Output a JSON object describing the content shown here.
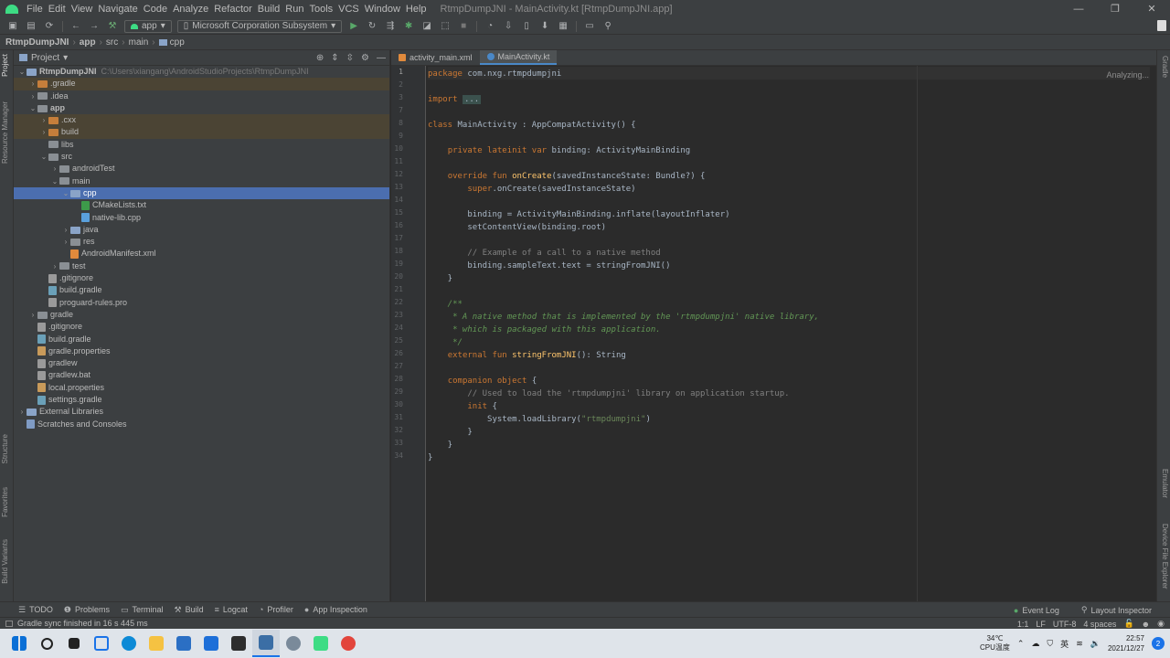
{
  "menubar": {
    "items": [
      "File",
      "Edit",
      "View",
      "Navigate",
      "Code",
      "Analyze",
      "Refactor",
      "Build",
      "Run",
      "Tools",
      "VCS",
      "Window",
      "Help"
    ],
    "window_title": "RtmpDumpJNI - MainActivity.kt [RtmpDumpJNI.app]",
    "minimize": "—",
    "maximize": "❐",
    "close": "✕"
  },
  "toolbar": {
    "run_config": "app",
    "device": "Microsoft Corporation Subsystem"
  },
  "breadcrumb": [
    "RtmpDumpJNI",
    "app",
    "src",
    "main",
    "cpp"
  ],
  "left_stripe": {
    "project": "Project",
    "resource_manager": "Resource Manager",
    "structure": "Structure",
    "favorites": "Favorites",
    "build_variants": "Build Variants"
  },
  "right_stripe": {
    "gradle": "Gradle",
    "emulator": "Emulator",
    "device_file_explorer": "Device File Explorer"
  },
  "project_panel": {
    "title": "Project",
    "tree": [
      {
        "label": "RtmpDumpJNI",
        "path": "C:\\Users\\xiangang\\AndroidStudioProjects\\RtmpDumpJNI",
        "depth": 0,
        "arrow": "⌄",
        "kind": "module",
        "bold": true
      },
      {
        "label": ".gradle",
        "depth": 1,
        "arrow": "›",
        "kind": "folder-orange",
        "hl": true
      },
      {
        "label": ".idea",
        "depth": 1,
        "arrow": "›",
        "kind": "folder"
      },
      {
        "label": "app",
        "depth": 1,
        "arrow": "⌄",
        "kind": "folder",
        "bold": true
      },
      {
        "label": ".cxx",
        "depth": 2,
        "arrow": "›",
        "kind": "folder-orange",
        "hl": true
      },
      {
        "label": "build",
        "depth": 2,
        "arrow": "›",
        "kind": "folder-orange",
        "hl": true
      },
      {
        "label": "libs",
        "depth": 2,
        "arrow": "",
        "kind": "folder"
      },
      {
        "label": "src",
        "depth": 2,
        "arrow": "⌄",
        "kind": "folder"
      },
      {
        "label": "androidTest",
        "depth": 3,
        "arrow": "›",
        "kind": "folder"
      },
      {
        "label": "main",
        "depth": 3,
        "arrow": "⌄",
        "kind": "folder"
      },
      {
        "label": "cpp",
        "depth": 4,
        "arrow": "⌄",
        "kind": "folder-blue",
        "sel": true
      },
      {
        "label": "CMakeLists.txt",
        "depth": 5,
        "arrow": "",
        "kind": "cmake"
      },
      {
        "label": "native-lib.cpp",
        "depth": 5,
        "arrow": "",
        "kind": "cpp"
      },
      {
        "label": "java",
        "depth": 4,
        "arrow": "›",
        "kind": "folder-blue"
      },
      {
        "label": "res",
        "depth": 4,
        "arrow": "›",
        "kind": "folder"
      },
      {
        "label": "AndroidManifest.xml",
        "depth": 4,
        "arrow": "",
        "kind": "xml"
      },
      {
        "label": "test",
        "depth": 3,
        "arrow": "›",
        "kind": "folder"
      },
      {
        "label": ".gitignore",
        "depth": 2,
        "arrow": "",
        "kind": "file"
      },
      {
        "label": "build.gradle",
        "depth": 2,
        "arrow": "",
        "kind": "gradle"
      },
      {
        "label": "proguard-rules.pro",
        "depth": 2,
        "arrow": "",
        "kind": "file"
      },
      {
        "label": "gradle",
        "depth": 1,
        "arrow": "›",
        "kind": "folder"
      },
      {
        "label": ".gitignore",
        "depth": 1,
        "arrow": "",
        "kind": "file"
      },
      {
        "label": "build.gradle",
        "depth": 1,
        "arrow": "",
        "kind": "gradle"
      },
      {
        "label": "gradle.properties",
        "depth": 1,
        "arrow": "",
        "kind": "props"
      },
      {
        "label": "gradlew",
        "depth": 1,
        "arrow": "",
        "kind": "file"
      },
      {
        "label": "gradlew.bat",
        "depth": 1,
        "arrow": "",
        "kind": "file"
      },
      {
        "label": "local.properties",
        "depth": 1,
        "arrow": "",
        "kind": "props"
      },
      {
        "label": "settings.gradle",
        "depth": 1,
        "arrow": "",
        "kind": "gradle"
      },
      {
        "label": "External Libraries",
        "depth": 0,
        "arrow": "›",
        "kind": "lib"
      },
      {
        "label": "Scratches and Consoles",
        "depth": 0,
        "arrow": "",
        "kind": "scratch"
      }
    ]
  },
  "editor": {
    "tabs": [
      {
        "label": "activity_main.xml",
        "active": false
      },
      {
        "label": "MainActivity.kt",
        "active": true
      }
    ],
    "status": "Analyzing...",
    "lines": [
      {
        "n": "1",
        "parts": [
          [
            "kw",
            "package "
          ],
          [
            "",
            "com.nxg.rtmpdumpjni"
          ]
        ]
      },
      {
        "n": "2",
        "parts": []
      },
      {
        "n": "3",
        "parts": [
          [
            "kw",
            "import "
          ],
          [
            "fold",
            "..."
          ]
        ]
      },
      {
        "n": "7",
        "parts": []
      },
      {
        "n": "8",
        "parts": [
          [
            "kw",
            "class "
          ],
          [
            "",
            "MainActivity : AppCompatActivity() {"
          ]
        ]
      },
      {
        "n": "9",
        "parts": []
      },
      {
        "n": "10",
        "parts": [
          [
            "",
            "    "
          ],
          [
            "kw",
            "private lateinit var "
          ],
          [
            "",
            "binding: ActivityMainBinding"
          ]
        ]
      },
      {
        "n": "11",
        "parts": []
      },
      {
        "n": "12",
        "parts": [
          [
            "",
            "    "
          ],
          [
            "kw",
            "override fun "
          ],
          [
            "fn",
            "onCreate"
          ],
          [
            "",
            "(savedInstanceState: Bundle?) {"
          ]
        ]
      },
      {
        "n": "13",
        "parts": [
          [
            "",
            "        "
          ],
          [
            "kw",
            "super"
          ],
          [
            "",
            ".onCreate(savedInstanceState)"
          ]
        ]
      },
      {
        "n": "14",
        "parts": []
      },
      {
        "n": "15",
        "parts": [
          [
            "",
            "        binding = ActivityMainBinding.inflate(layoutInflater)"
          ]
        ]
      },
      {
        "n": "16",
        "parts": [
          [
            "",
            "        setContentView(binding.root)"
          ]
        ]
      },
      {
        "n": "17",
        "parts": []
      },
      {
        "n": "18",
        "parts": [
          [
            "cm",
            "        // Example of a call to a native method"
          ]
        ]
      },
      {
        "n": "19",
        "parts": [
          [
            "",
            "        binding.sampleText.text = stringFromJNI()"
          ]
        ]
      },
      {
        "n": "20",
        "parts": [
          [
            "",
            "    }"
          ]
        ]
      },
      {
        "n": "21",
        "parts": []
      },
      {
        "n": "22",
        "parts": [
          [
            "doc",
            "    /**"
          ]
        ]
      },
      {
        "n": "23",
        "parts": [
          [
            "doc",
            "     * A native method that is implemented by the 'rtmpdumpjni' native library,"
          ]
        ]
      },
      {
        "n": "24",
        "parts": [
          [
            "doc",
            "     * which is packaged with this application."
          ]
        ]
      },
      {
        "n": "25",
        "parts": [
          [
            "doc",
            "     */"
          ]
        ]
      },
      {
        "n": "26",
        "parts": [
          [
            "",
            "    "
          ],
          [
            "kw",
            "external fun "
          ],
          [
            "fn",
            "stringFromJNI"
          ],
          [
            "",
            "(): String"
          ]
        ]
      },
      {
        "n": "27",
        "parts": []
      },
      {
        "n": "28",
        "parts": [
          [
            "",
            "    "
          ],
          [
            "kw",
            "companion object "
          ],
          [
            "",
            "{"
          ]
        ]
      },
      {
        "n": "29",
        "parts": [
          [
            "cm",
            "        // Used to load the 'rtmpdumpjni' library on application startup."
          ]
        ]
      },
      {
        "n": "30",
        "parts": [
          [
            "",
            "        "
          ],
          [
            "kw",
            "init "
          ],
          [
            "",
            "{"
          ]
        ]
      },
      {
        "n": "31",
        "parts": [
          [
            "",
            "            System.loadLibrary("
          ],
          [
            "str",
            "\"rtmpdumpjni\""
          ],
          [
            "",
            ")"
          ]
        ]
      },
      {
        "n": "32",
        "parts": [
          [
            "",
            "        }"
          ]
        ]
      },
      {
        "n": "33",
        "parts": [
          [
            "",
            "    }"
          ]
        ]
      },
      {
        "n": "34",
        "parts": [
          [
            "",
            "}"
          ]
        ]
      }
    ]
  },
  "bottom_tools": {
    "items": [
      {
        "icon": "☰",
        "label": "TODO",
        "name": "todo"
      },
      {
        "icon": "❶",
        "label": "Problems",
        "name": "problems"
      },
      {
        "icon": "▭",
        "label": "Terminal",
        "name": "terminal"
      },
      {
        "icon": "⚒",
        "label": "Build",
        "name": "build"
      },
      {
        "icon": "≡",
        "label": "Logcat",
        "name": "logcat"
      },
      {
        "icon": "◔",
        "label": "Profiler",
        "name": "profiler"
      },
      {
        "icon": "●",
        "label": "App Inspection",
        "name": "app-inspection"
      }
    ],
    "event_log": "Event Log",
    "layout_inspector": "Layout Inspector"
  },
  "statusbar": {
    "message": "Gradle sync finished in 16 s 445 ms",
    "position": "1:1",
    "line_sep": "LF",
    "encoding": "UTF-8",
    "indent": "4 spaces"
  },
  "taskbar": {
    "temperature": "34℃",
    "cpu_label": "CPU温度",
    "ime": "英",
    "time": "22:57",
    "date": "2021/12/27",
    "notifications": "2"
  },
  "colors": {
    "keyword": "#cc7832",
    "function": "#ffc66d",
    "string": "#6a8759",
    "comment": "#808080",
    "doc": "#629755",
    "selection": "#4b6eaf"
  }
}
